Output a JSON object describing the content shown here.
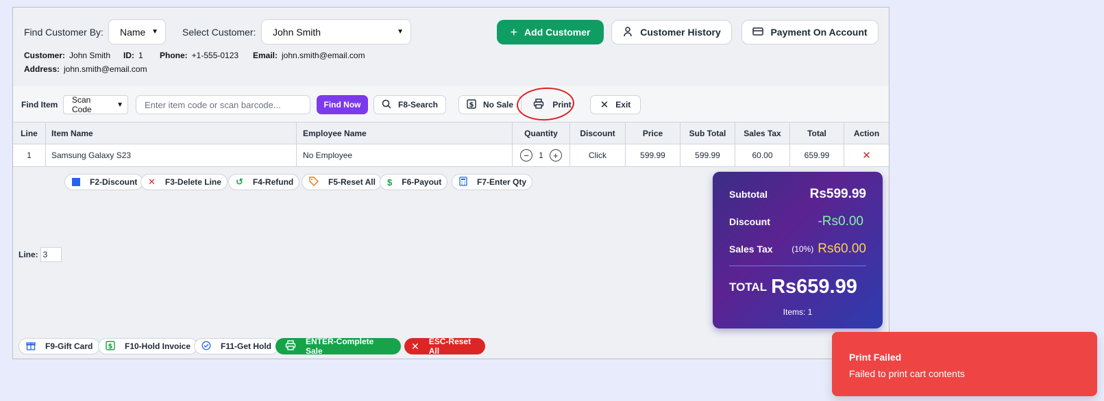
{
  "customer": {
    "find_by_label": "Find Customer By:",
    "find_by_value": "Name",
    "select_label": "Select Customer:",
    "select_value": "John Smith",
    "add_label": "Add Customer",
    "history_label": "Customer History",
    "payment_label": "Payment On Account",
    "info": {
      "customer_label": "Customer:",
      "customer_value": "John Smith",
      "id_label": "ID:",
      "id_value": "1",
      "phone_label": "Phone:",
      "phone_value": "+1-555-0123",
      "email_label": "Email:",
      "email_value": "john.smith@email.com",
      "address_label": "Address:",
      "address_value": "john.smith@email.com"
    }
  },
  "item_bar": {
    "find_label": "Find Item",
    "mode_value": "Scan Code",
    "search_placeholder": "Enter item code or scan barcode...",
    "find_now": "Find Now",
    "f8": "F8-Search",
    "no_sale": "No Sale",
    "print": "Print",
    "exit": "Exit"
  },
  "table": {
    "headers": [
      "Line",
      "Item Name",
      "Employee Name",
      "Quantity",
      "Discount",
      "Price",
      "Sub Total",
      "Sales Tax",
      "Total",
      "Action"
    ],
    "rows": [
      {
        "line": "1",
        "item": "Samsung Galaxy S23",
        "employee": "No Employee",
        "qty": "1",
        "discount": "Click",
        "price": "599.99",
        "subtotal": "599.99",
        "tax": "60.00",
        "total": "659.99"
      }
    ]
  },
  "fkeys": {
    "f2": "F2-Discount",
    "f3": "F3-Delete Line",
    "f4": "F4-Refund",
    "f5": "F5-Reset All",
    "f6": "F6-Payout",
    "f7": "F7-Enter Qty"
  },
  "line": {
    "label": "Line:",
    "value": "3"
  },
  "summary": {
    "subtotal_label": "Subtotal",
    "subtotal_value": "Rs599.99",
    "discount_label": "Discount",
    "discount_value": "-Rs0.00",
    "tax_label": "Sales Tax",
    "tax_rate": "(10%)",
    "tax_value": "Rs60.00",
    "total_label": "TOTAL",
    "total_value": "Rs659.99",
    "items": "Items: 1"
  },
  "bottom": {
    "f9": "F9-Gift Card",
    "f10": "F10-Hold Invoice",
    "f11": "F11-Get Hold",
    "enter": "ENTER-Complete Sale",
    "esc": "ESC-Reset All"
  },
  "toast": {
    "title": "Print Failed",
    "message": "Failed to print cart contents"
  },
  "colors": {
    "green": "#0f9d63",
    "purple": "#7c3aed",
    "red": "#dc2626",
    "toast": "#ef4444"
  }
}
